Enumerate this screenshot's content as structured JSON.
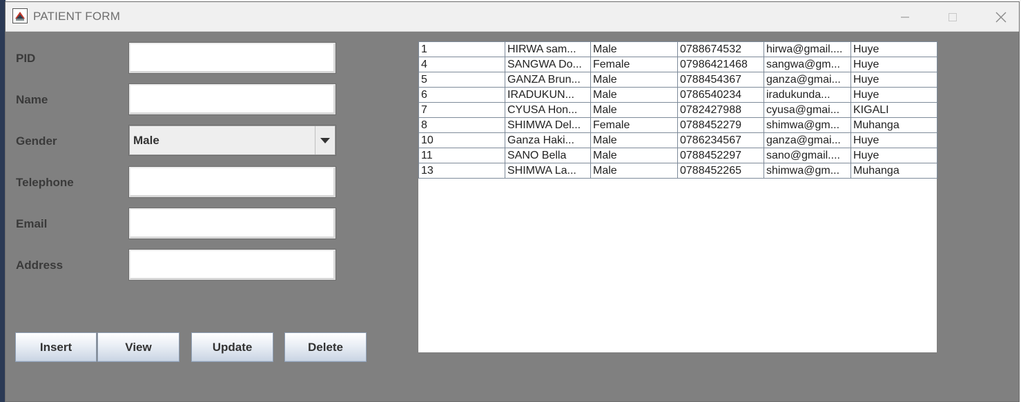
{
  "window": {
    "title": "PATIENT FORM",
    "controls": {
      "minimize": "—",
      "maximize": "□",
      "close": "✕"
    }
  },
  "form": {
    "labels": {
      "pid": "PID",
      "name": "Name",
      "gender": "Gender",
      "telephone": "Telephone",
      "email": "Email",
      "address": "Address"
    },
    "values": {
      "pid": "",
      "name": "",
      "telephone": "",
      "email": "",
      "address": ""
    },
    "gender_selected": "Male"
  },
  "buttons": {
    "insert": "Insert",
    "view": "View",
    "update": "Update",
    "delete": "Delete"
  },
  "table": {
    "rows": [
      [
        "1",
        "HIRWA  sam...",
        "Male",
        "0788674532",
        "hirwa@gmail....",
        "Huye"
      ],
      [
        "4",
        "SANGWA Do...",
        "Female",
        "07986421468",
        "sangwa@gm...",
        "Huye"
      ],
      [
        "5",
        "GANZA Brun...",
        "Male",
        "0788454367",
        "ganza@gmai...",
        "Huye"
      ],
      [
        "6",
        "IRADUKUN...",
        "Male",
        "0786540234",
        "iradukunda...",
        "Huye"
      ],
      [
        "7",
        "CYUSA Hon...",
        "Male",
        "0782427988",
        "cyusa@gmai...",
        "KIGALI"
      ],
      [
        "8",
        "SHIMWA Del...",
        "Female",
        "0788452279",
        "shimwa@gm...",
        "Muhanga"
      ],
      [
        "10",
        "Ganza Haki...",
        "Male",
        "0786234567",
        "ganza@gmai...",
        "Huye"
      ],
      [
        "11",
        "SANO Bella",
        "Male",
        "0788452297",
        "sano@gmail....",
        "Huye"
      ],
      [
        "13",
        "SHIMWA La...",
        "Male",
        "0788452265",
        "shimwa@gm...",
        "Muhanga"
      ]
    ]
  }
}
